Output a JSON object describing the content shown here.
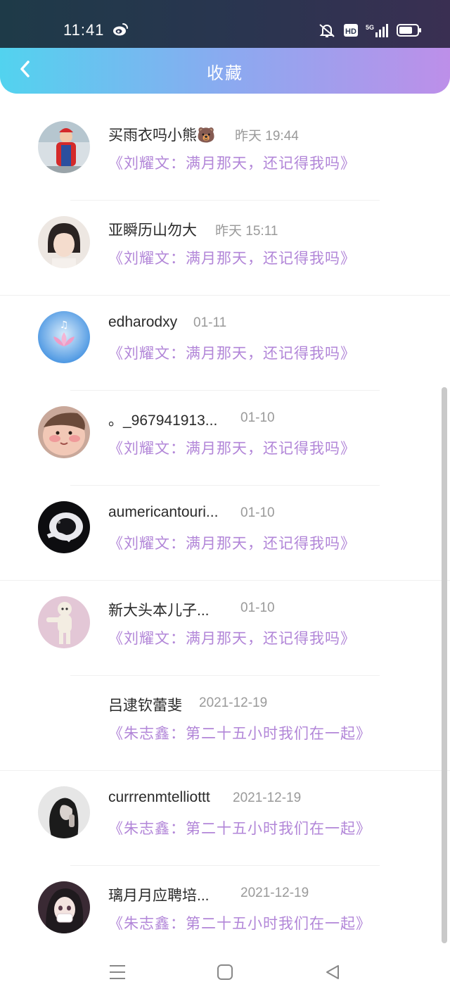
{
  "status_bar": {
    "time": "11:41",
    "network": "5G",
    "hd": "HD"
  },
  "header": {
    "title": "收藏"
  },
  "items": [
    {
      "name": "买雨衣吗小熊🐻",
      "time": "昨天 19:44",
      "title": "《刘耀文：满月那天，还记得我吗》",
      "avatar": "red-cap-person-avatar"
    },
    {
      "name": "亚瞬历山勿大",
      "time": "昨天 15:11",
      "title": "《刘耀文：满月那天，还记得我吗》",
      "avatar": "short-hair-girl-avatar"
    },
    {
      "name": "edharodxy",
      "time": "01-11",
      "title": "《刘耀文：满月那天，还记得我吗》",
      "avatar": "blue-lotus-avatar"
    },
    {
      "name": "。_967941913...",
      "time": "01-10",
      "title": "《刘耀文：满月那天，还记得我吗》",
      "avatar": "baby-face-avatar"
    },
    {
      "name": "aumericantouri...",
      "time": "01-10",
      "title": "《刘耀文：满月那天，还记得我吗》",
      "avatar": "black-white-cat-avatar"
    },
    {
      "name": "新大头本儿子...",
      "time": "01-10",
      "title": "《刘耀文：满月那天，还记得我吗》",
      "avatar": "dog-pink-bg-avatar"
    },
    {
      "name": "吕逮钦蕾斐",
      "time": "2021-12-19",
      "title": "《朱志鑫：第二十五小时我们在一起》",
      "avatar": "none"
    },
    {
      "name": "currrenmtelliottt",
      "time": "2021-12-19",
      "title": "《朱志鑫：第二十五小时我们在一起》",
      "avatar": "dark-hair-girl-avatar"
    },
    {
      "name": "璃月月应聘培...",
      "time": "2021-12-19",
      "title": "《朱志鑫：第二十五小时我们在一起》",
      "avatar": "anime-girl-mask-avatar"
    }
  ],
  "nav": {
    "menu_icon": "menu-icon",
    "home_icon": "home-square-icon",
    "back_icon": "back-triangle-icon"
  },
  "colors": {
    "accent_title": "#b286d8",
    "header_start": "#52d3ef",
    "header_end": "#bd8fe9"
  }
}
